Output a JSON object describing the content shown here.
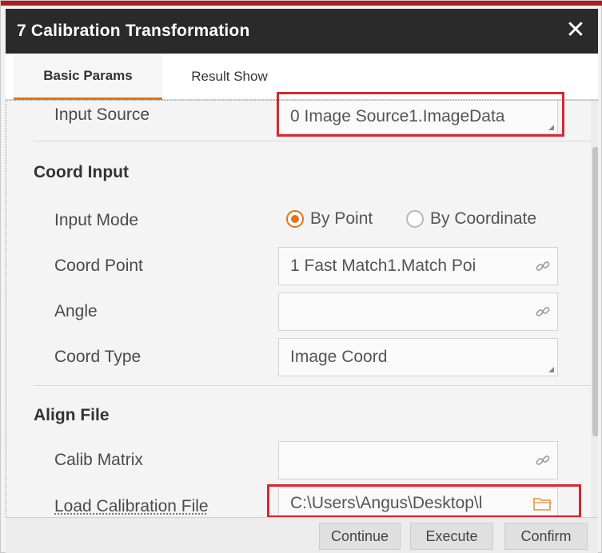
{
  "dialog": {
    "title": "7 Calibration Transformation",
    "close_icon": "close-icon"
  },
  "tabs": [
    {
      "label": "Basic Params",
      "active": true
    },
    {
      "label": "Result Show",
      "active": false
    }
  ],
  "input_source": {
    "label": "Input Source",
    "value": "0 Image Source1.ImageData"
  },
  "coord_input": {
    "heading": "Coord Input",
    "input_mode": {
      "label": "Input Mode",
      "options": [
        "By Point",
        "By Coordinate"
      ],
      "selected": "By Point"
    },
    "coord_point": {
      "label": "Coord Point",
      "value": "1 Fast Match1.Match Poi",
      "icon": "link-icon"
    },
    "angle": {
      "label": "Angle",
      "value": "",
      "icon": "link-icon"
    },
    "coord_type": {
      "label": "Coord Type",
      "value": "Image Coord"
    }
  },
  "align_file": {
    "heading": "Align File",
    "calib_matrix": {
      "label": "Calib Matrix",
      "value": "",
      "icon": "link-icon"
    },
    "load_calibration_file": {
      "label": "Load Calibration File",
      "value": "C:\\Users\\Angus\\Desktop\\l",
      "icon": "folder-icon"
    }
  },
  "buttons": {
    "continue": "Continue",
    "execute": "Execute",
    "confirm": "Confirm"
  },
  "colors": {
    "accent": "#e2731b",
    "highlight": "#d9262f",
    "titlebar": "#2a2a2a"
  }
}
